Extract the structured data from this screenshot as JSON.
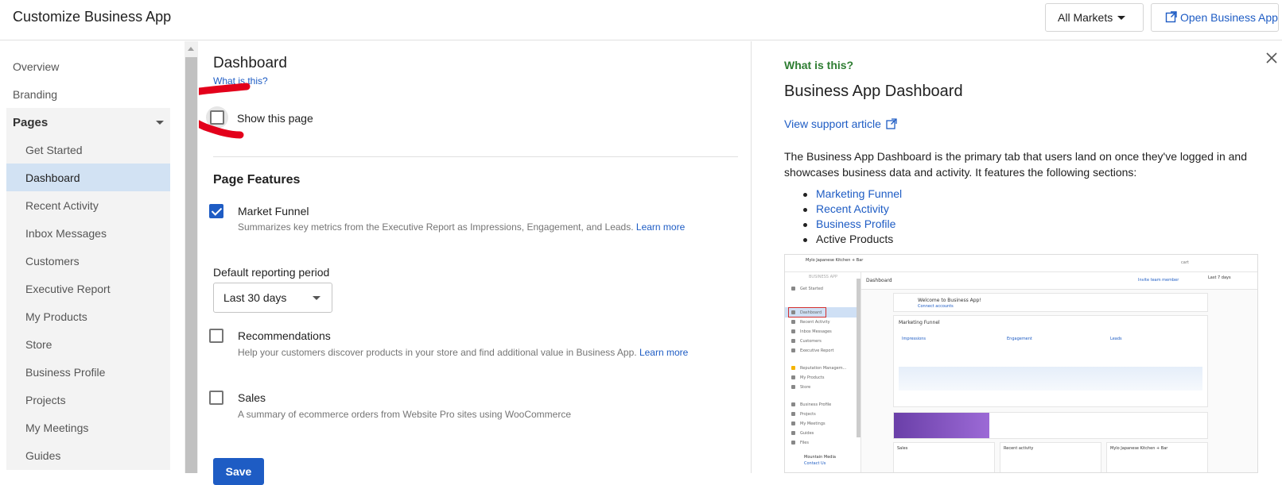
{
  "header": {
    "title": "Customize Business App",
    "market_select": "All Markets",
    "open_button": "Open Business App"
  },
  "sidebar": {
    "items": [
      {
        "label": "Overview"
      },
      {
        "label": "Branding"
      },
      {
        "label": "Pages"
      },
      {
        "label": "Get Started"
      },
      {
        "label": "Dashboard"
      },
      {
        "label": "Recent Activity"
      },
      {
        "label": "Inbox Messages"
      },
      {
        "label": "Customers"
      },
      {
        "label": "Executive Report"
      },
      {
        "label": "My Products"
      },
      {
        "label": "Store"
      },
      {
        "label": "Business Profile"
      },
      {
        "label": "Projects"
      },
      {
        "label": "My Meetings"
      },
      {
        "label": "Guides"
      }
    ],
    "active_item": "Dashboard"
  },
  "main": {
    "page_title": "Dashboard",
    "what_is_this": "What is this?",
    "show_page_label": "Show this page",
    "show_page_checked": false,
    "features_heading": "Page Features",
    "features": [
      {
        "title": "Market Funnel",
        "desc": "Summarizes key metrics from the Executive Report as Impressions, Engagement, and Leads.",
        "link": "Learn more",
        "checked": true
      },
      {
        "title": "Recommendations",
        "desc": "Help your customers discover products in your store and find additional value in Business App.",
        "link": "Learn more",
        "checked": false
      },
      {
        "title": "Sales",
        "desc": "A summary of ecommerce orders from Website Pro sites using WooCommerce",
        "link": "",
        "checked": false
      }
    ],
    "period_label": "Default reporting period",
    "period_value": "Last 30 days",
    "save_label": "Save"
  },
  "info_panel": {
    "eyebrow": "What is this?",
    "title": "Business App Dashboard",
    "support_link": "View support article",
    "description": "The Business App Dashboard is the primary tab that users land on once they've logged in and showcases business data and activity. It features the following sections:",
    "sections": [
      {
        "label": "Marketing Funnel",
        "is_link": true
      },
      {
        "label": "Recent Activity",
        "is_link": true
      },
      {
        "label": "Business Profile",
        "is_link": true
      },
      {
        "label": "Active Products",
        "is_link": false
      }
    ]
  },
  "preview": {
    "business_name": "Mylo Japanese Kitchen + Bar",
    "section_label": "BUSINESS APP",
    "page_title": "Dashboard",
    "welcome": "Welcome to Business App!",
    "connect_accounts": "Connect accounts",
    "funnel_title": "Marketing Funnel",
    "funnel_steps": [
      "Impressions",
      "Engagement",
      "Leads"
    ],
    "range_label": "Last 7 days",
    "cart": "cart",
    "invite": "Invite team member",
    "nav": [
      "Get Started",
      "Dashboard",
      "Recent Activity",
      "Inbox Messages",
      "Customers",
      "Executive Report",
      "Reputation Managem...",
      "My Products",
      "Store",
      "Business Profile",
      "Projects",
      "My Meetings",
      "Guides",
      "Files"
    ],
    "bottom_cards": [
      "Sales",
      "Recent activity"
    ],
    "footer_user": "Mountain Media",
    "footer_user_sub": "Contact Us"
  },
  "colors": {
    "accent": "#1e5cc4",
    "eyebrow": "#2e7d32",
    "active_nav_bg": "#d2e2f3",
    "annotation": "#e3001b"
  }
}
